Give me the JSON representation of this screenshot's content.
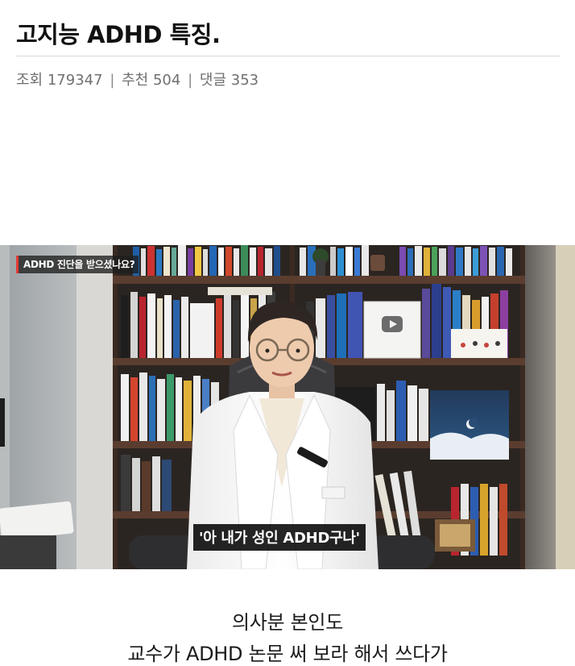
{
  "post": {
    "title": "고지능 ADHD 특징.",
    "meta": {
      "views_label": "조회",
      "views": "179347",
      "recommend_label": "추천",
      "recommend": "504",
      "comments_label": "댓글",
      "comments": "353",
      "separator": "|"
    }
  },
  "video": {
    "corner_label": "ADHD 진단을 받으셨나요?",
    "subtitle": "'아 내가 성인 ADHD구나'",
    "accent_color": "#e53935"
  },
  "caption": {
    "line1": "의사분 본인도",
    "line2": "교수가 ADHD 논문 써 보라 해서 쓰다가"
  }
}
